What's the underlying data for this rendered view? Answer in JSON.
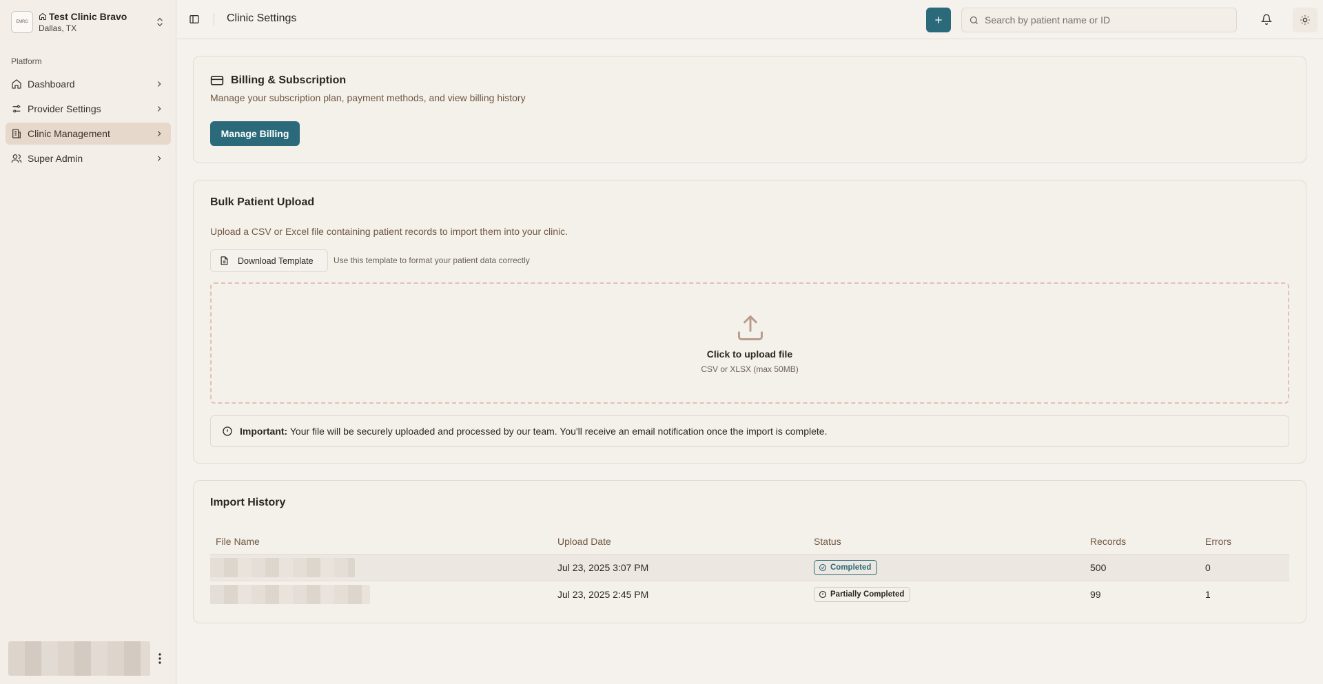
{
  "sidebar": {
    "clinic_logo_text": "EMRG",
    "clinic_name": "Test Clinic Bravo",
    "clinic_location": "Dallas, TX",
    "section_label": "Platform",
    "items": [
      {
        "label": "Dashboard",
        "icon": "home-icon",
        "active": false
      },
      {
        "label": "Provider Settings",
        "icon": "sliders-icon",
        "active": false
      },
      {
        "label": "Clinic Management",
        "icon": "building-icon",
        "active": true
      },
      {
        "label": "Super Admin",
        "icon": "users-icon",
        "active": false
      }
    ]
  },
  "header": {
    "title": "Clinic Settings",
    "search_placeholder": "Search by patient name or ID"
  },
  "billing": {
    "title": "Billing & Subscription",
    "description": "Manage your subscription plan, payment methods, and view billing history",
    "button_label": "Manage Billing"
  },
  "upload": {
    "title": "Bulk Patient Upload",
    "description": "Upload a CSV or Excel file containing patient records to import them into your clinic.",
    "download_label": "Download Template",
    "download_hint": "Use this template to format your patient data correctly",
    "dropzone_title": "Click to upload file",
    "dropzone_sub": "CSV or XLSX (max 50MB)",
    "notice_label": "Important:",
    "notice_text": "Your file will be securely uploaded and processed by our team. You'll receive an email notification once the import is complete."
  },
  "history": {
    "title": "Import History",
    "columns": [
      "File Name",
      "Upload Date",
      "Status",
      "Records",
      "Errors"
    ],
    "rows": [
      {
        "upload_date": "Jul 23, 2025 3:07 PM",
        "status": "Completed",
        "records": "500",
        "errors": "0"
      },
      {
        "upload_date": "Jul 23, 2025 2:45 PM",
        "status": "Partially Completed",
        "records": "99",
        "errors": "1"
      }
    ]
  },
  "colors": {
    "accent": "#2a6a7a",
    "background": "#f5f1ec",
    "active_nav": "#e6d9cc"
  }
}
